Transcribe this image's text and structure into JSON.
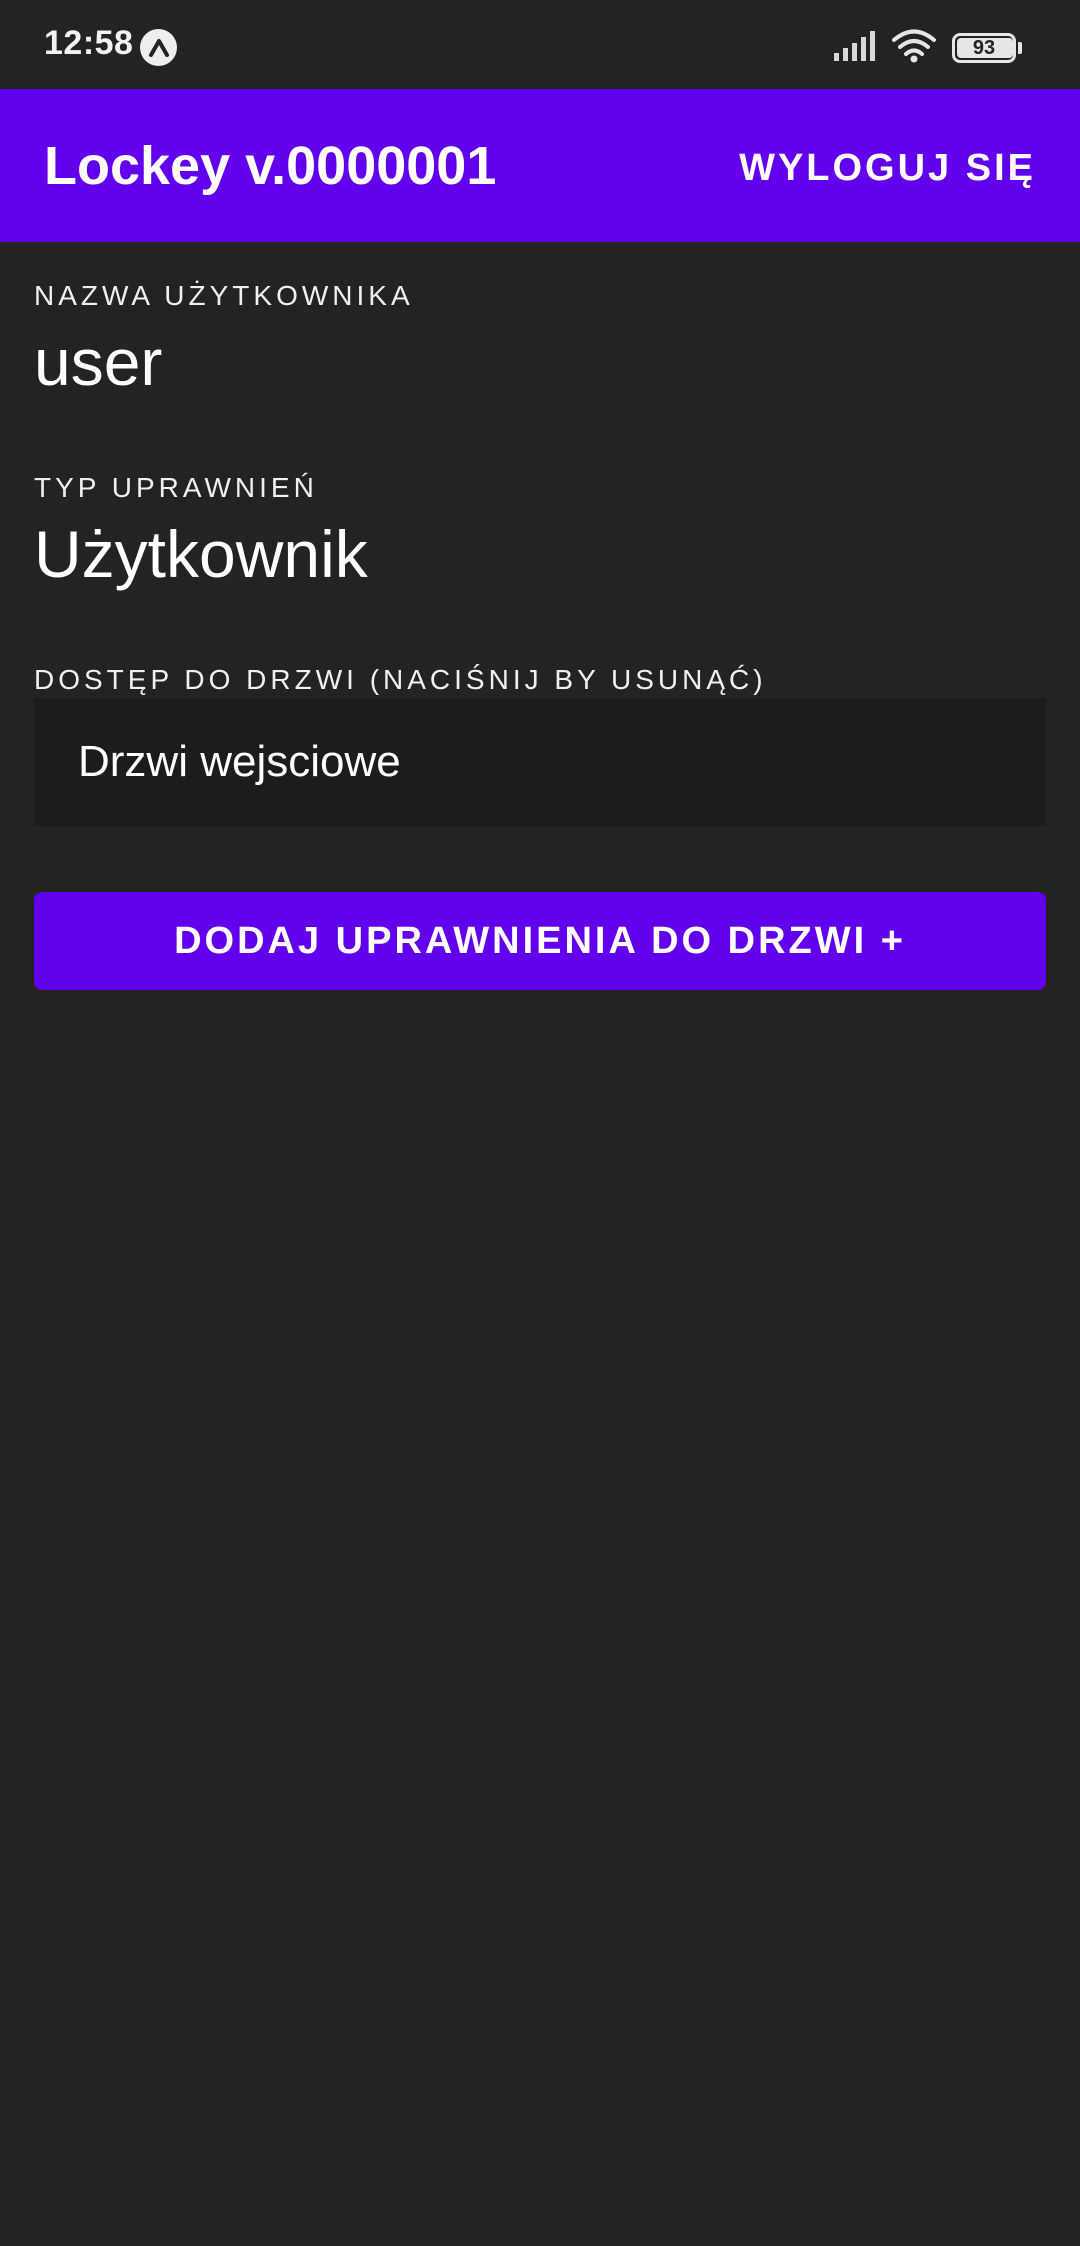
{
  "status_bar": {
    "time": "12:58",
    "battery_level": "93",
    "icons": [
      "app-badge-icon",
      "signal-icon",
      "wifi-icon",
      "battery-icon"
    ]
  },
  "app_bar": {
    "title": "Lockey v.0000001",
    "logout_label": "WYLOGUJ SIĘ"
  },
  "profile": {
    "username_label": "NAZWA UŻYTKOWNIKA",
    "username_value": "user",
    "permission_label": "TYP UPRAWNIEŃ",
    "permission_value": "Użytkownik",
    "doors_label": "DOSTĘP DO DRZWI (NACIŚNIJ BY USUNĄĆ)",
    "doors": [
      {
        "name": "Drzwi wejsciowe"
      }
    ]
  },
  "actions": {
    "add_door_label": "DODAJ UPRAWNIENIA DO DRZWI +"
  },
  "colors": {
    "accent": "#6200ee",
    "background": "#232323",
    "item_background": "#1c1c1c"
  }
}
